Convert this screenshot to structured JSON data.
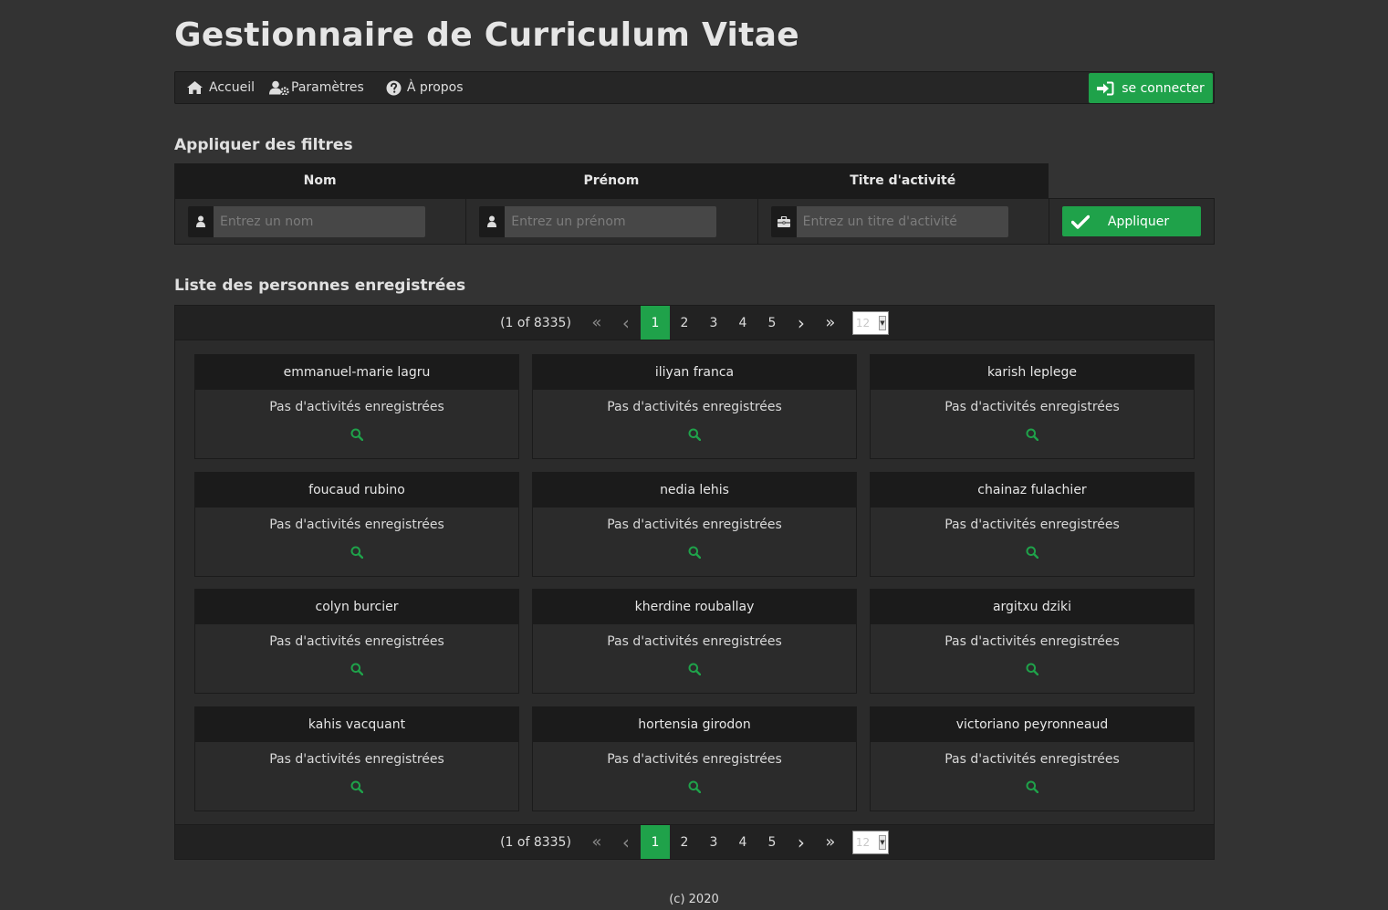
{
  "app": {
    "title": "Gestionnaire de Curriculum Vitae"
  },
  "menu": {
    "home": "Accueil",
    "settings": "Paramètres",
    "about": "À propos",
    "login": "se connecter"
  },
  "filters": {
    "heading": "Appliquer des filtres",
    "name_label": "Nom",
    "firstname_label": "Prénom",
    "activity_label": "Titre d'activité",
    "name_placeholder": "Entrez un nom",
    "firstname_placeholder": "Entrez un prénom",
    "activity_placeholder": "Entrez un titre d'activité",
    "apply": "Appliquer"
  },
  "list": {
    "heading": "Liste des personnes enregistrées",
    "pager": {
      "report": "(1 of 8335)",
      "first": "«",
      "prev": "‹",
      "next": "›",
      "last": "»",
      "pages": [
        "1",
        "2",
        "3",
        "4",
        "5"
      ],
      "rows_per_page": "12"
    },
    "no_activity": "Pas d'activités enregistrées",
    "people": [
      "emmanuel-marie lagru",
      "iliyan franca",
      "karish leplege",
      "foucaud rubino",
      "nedia lehis",
      "chainaz fulachier",
      "colyn burcier",
      "kherdine rouballay",
      "argitxu dziki",
      "kahis vacquant",
      "hortensia girodon",
      "victoriano peyronneaud"
    ]
  },
  "footer": {
    "text": "(c) 2020"
  },
  "colors": {
    "accent": "#1fa24a",
    "background": "#333333",
    "panel": "#1b1b1b"
  }
}
